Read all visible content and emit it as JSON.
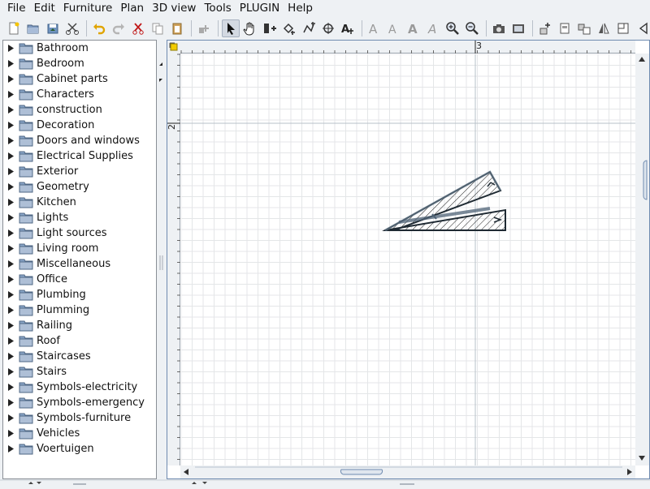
{
  "menu": [
    {
      "label": "File"
    },
    {
      "label": "Edit"
    },
    {
      "label": "Furniture"
    },
    {
      "label": "Plan"
    },
    {
      "label": "3D view"
    },
    {
      "label": "Tools"
    },
    {
      "label": "PLUGIN"
    },
    {
      "label": "Help"
    }
  ],
  "toolbar": {
    "icons": [
      "new-file-icon",
      "open-file-icon",
      "save-file-icon",
      "cut-scissors-icon",
      "undo-icon",
      "redo-icon",
      "delete-icon",
      "copy-icon",
      "paste-icon",
      "add-furniture-icon",
      "select-pointer-icon",
      "pan-hand-icon",
      "create-walls-icon",
      "create-rooms-icon",
      "create-polylines-icon",
      "create-dimensions-icon",
      "add-text-icon",
      "text-style-icon",
      "text-bold-icon",
      "text-plain-icon",
      "text-italic-icon",
      "zoom-in-icon",
      "zoom-out-icon",
      "camera-icon",
      "photo-icon",
      "import-furniture-icon",
      "export-icon",
      "group-icon",
      "flip-icon",
      "plan-view-icon",
      "more-icon"
    ]
  },
  "catalog": {
    "categories": [
      "Bathroom",
      "Bedroom",
      "Cabinet parts",
      "Characters",
      "construction",
      "Decoration",
      "Doors and windows",
      "Electrical Supplies",
      "Exterior",
      "Geometry",
      "Kitchen",
      "Lights",
      "Light sources",
      "Living room",
      "Miscellaneous",
      "Office",
      "Plumbing",
      "Plumming",
      "Railing",
      "Roof",
      "Staircases",
      "Stairs",
      "Symbols-electricity",
      "Symbols-emergency",
      "Symbols-furniture",
      "Vehicles",
      "Voertuigen"
    ]
  },
  "plan": {
    "ruler_top_label": "3",
    "ruler_left_label": "2",
    "colors": {
      "grid": "#e4e6e8",
      "major_grid": "#b7c0c9",
      "wall": "#2e3a46",
      "accent": "#6f8bb0"
    }
  }
}
